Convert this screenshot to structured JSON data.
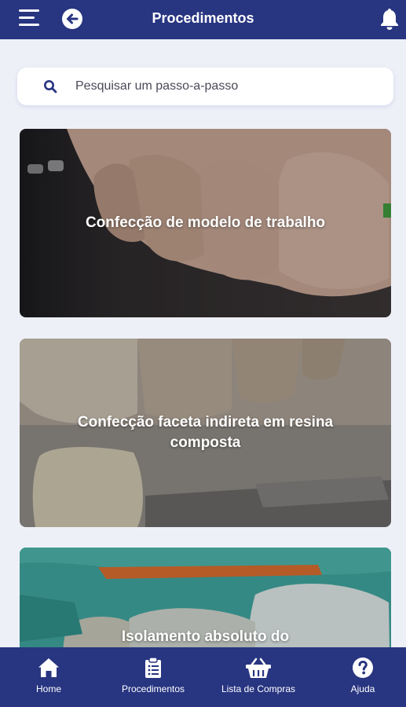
{
  "header": {
    "title": "Procedimentos",
    "menu_icon": "hamburger-menu-icon",
    "back_icon": "arrow-left-circle-icon",
    "bell_icon": "bell-icon"
  },
  "search": {
    "placeholder": "Pesquisar um passo-a-passo",
    "value": ""
  },
  "cards": [
    {
      "title": "Confecção de modelo de trabalho"
    },
    {
      "title": "Confecção faceta indireta em resina composta"
    },
    {
      "title": "Isolamento absoluto do"
    }
  ],
  "bottom_nav": {
    "items": [
      {
        "label": "Home",
        "icon": "home-icon"
      },
      {
        "label": "Procedimentos",
        "icon": "clipboard-icon"
      },
      {
        "label": "Lista de Compras",
        "icon": "basket-icon"
      },
      {
        "label": "Ajuda",
        "icon": "help-circle-icon"
      }
    ]
  },
  "colors": {
    "primary": "#283581",
    "background": "#eef0f8",
    "search_icon": "#283581"
  }
}
